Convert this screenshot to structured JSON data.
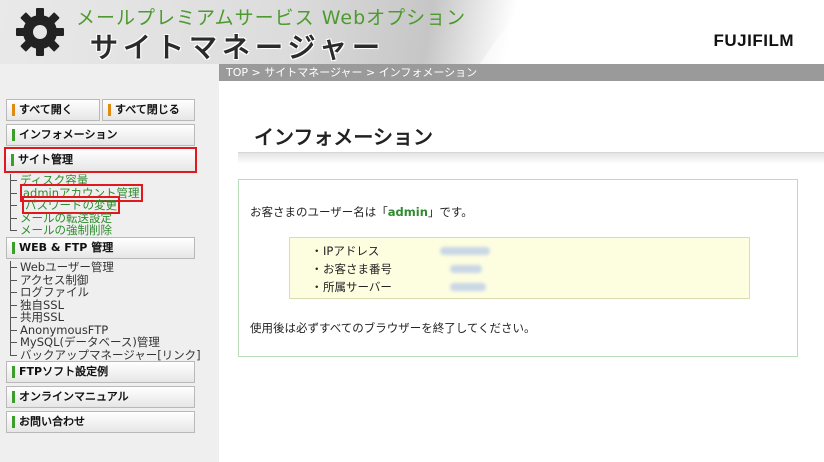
{
  "header": {
    "subtitle": "メールプレミアムサービス Webオプション",
    "title": "サイトマネージャー",
    "logo": "FUJIFILM"
  },
  "breadcrumb": "TOP > サイトマネージャー > インフォメーション",
  "sidebar": {
    "open_all": "すべて開く",
    "close_all": "すべて閉じる",
    "information": "インフォメーション",
    "site_admin": {
      "label": "サイト管理",
      "items": [
        "ディスク容量",
        "adminアカウント管理",
        "パスワードの変更",
        "メールの転送設定",
        "メールの強制削除"
      ]
    },
    "web_ftp": {
      "label": "WEB & FTP 管理",
      "items": [
        "Webユーザー管理",
        "アクセス制御",
        "ログファイル",
        "独自SSL",
        "共用SSL",
        "AnonymousFTP",
        "MySQL(データベース)管理",
        "バックアップマネージャー[リンク]"
      ]
    },
    "ftp_soft": "FTPソフト設定例",
    "manual": "オンラインマニュアル",
    "contact": "お問い合わせ"
  },
  "main": {
    "title": "インフォメーション",
    "greeting_prefix": "お客さまのユーザー名は「",
    "username": "admin",
    "greeting_suffix": "」です。",
    "details": [
      {
        "label": "IPアドレス"
      },
      {
        "label": "お客さま番号"
      },
      {
        "label": "所属サーバー"
      }
    ],
    "bullet": "・",
    "closing": "使用後は必ずすべてのブラウザーを終了してください。"
  },
  "colors": {
    "accent_green": "#2e8b2e",
    "highlight_red": "#e0191e",
    "bar_orange": "#e08a10"
  }
}
